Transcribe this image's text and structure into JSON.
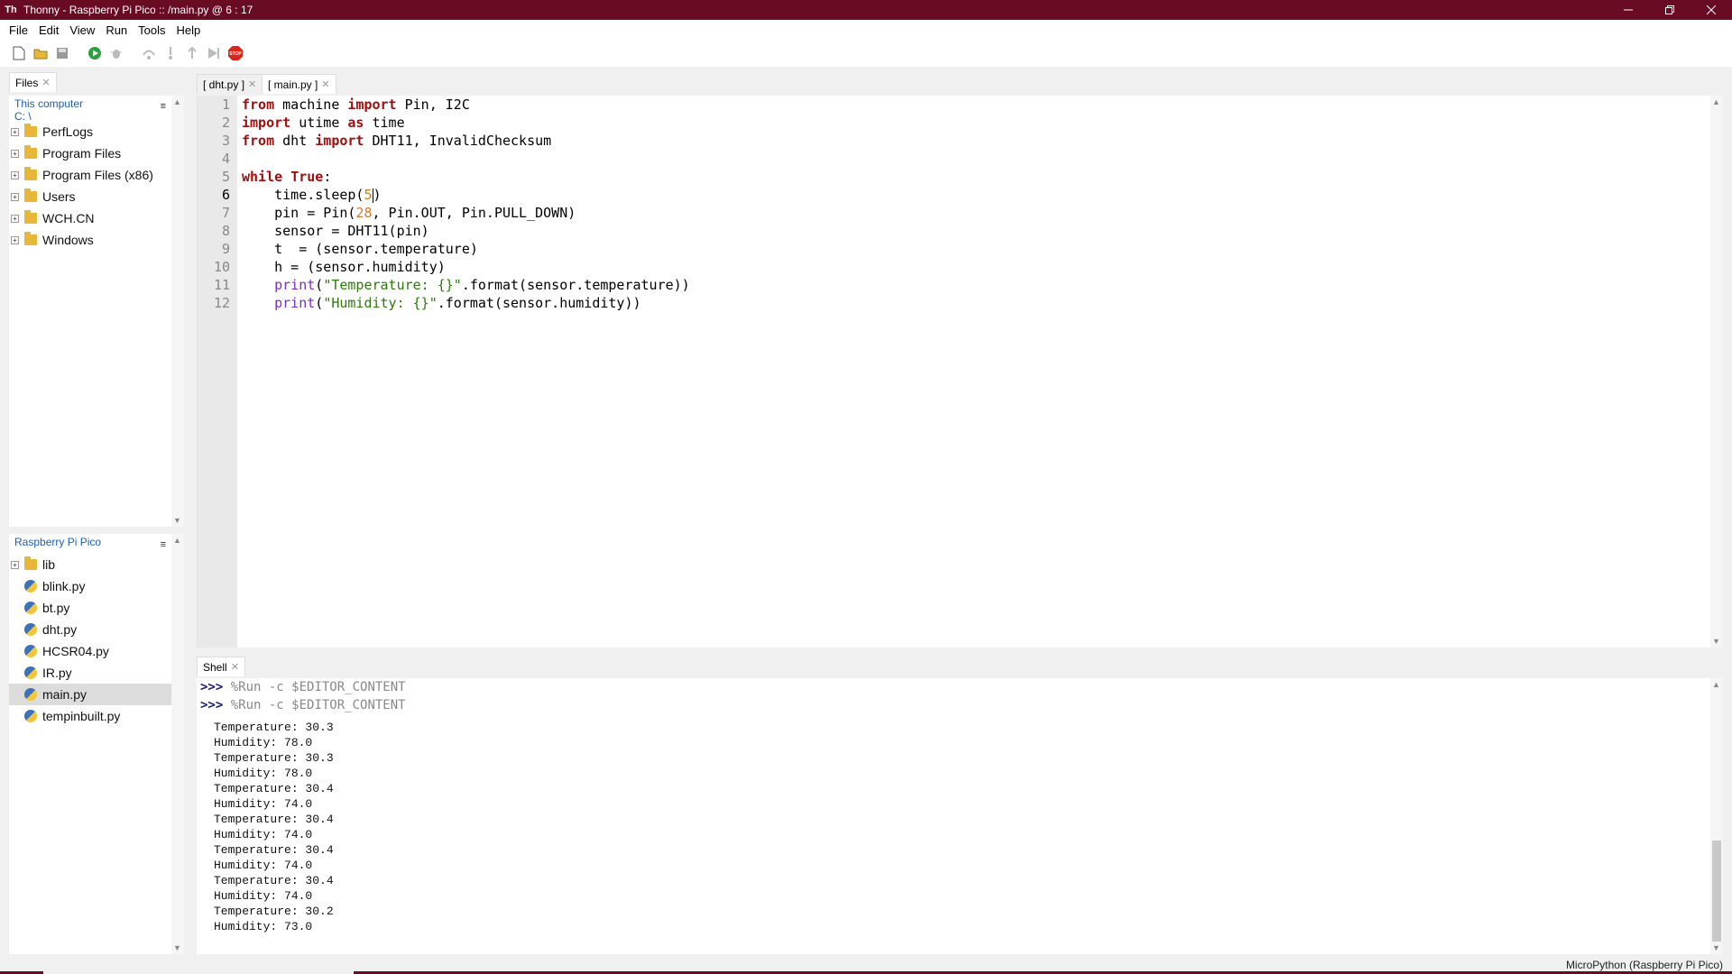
{
  "window": {
    "title": "Thonny  -  Raspberry Pi Pico :: /main.py  @  6 : 17"
  },
  "menu": [
    "File",
    "Edit",
    "View",
    "Run",
    "Tools",
    "Help"
  ],
  "toolbar": {
    "icons": [
      "new-file-icon",
      "open-file-icon",
      "save-icon",
      "run-icon",
      "debug-icon",
      "step-over-icon",
      "step-into-icon",
      "step-out-icon",
      "resume-icon",
      "stop-icon"
    ],
    "stop_label": "STOP"
  },
  "files_panel": {
    "tab_label": "Files",
    "computer": {
      "title": "This computer",
      "path": "C: \\",
      "items": [
        "PerfLogs",
        "Program Files",
        "Program Files (x86)",
        "Users",
        "WCH.CN",
        "Windows"
      ]
    },
    "pico": {
      "title": "Raspberry Pi Pico",
      "items": [
        {
          "name": "lib",
          "type": "folder"
        },
        {
          "name": "blink.py",
          "type": "py"
        },
        {
          "name": "bt.py",
          "type": "py"
        },
        {
          "name": "dht.py",
          "type": "py"
        },
        {
          "name": "HCSR04.py",
          "type": "py"
        },
        {
          "name": "IR.py",
          "type": "py"
        },
        {
          "name": "main.py",
          "type": "py",
          "selected": true
        },
        {
          "name": "tempinbuilt.py",
          "type": "py"
        }
      ]
    }
  },
  "editor": {
    "tabs": [
      "[ dht.py ]",
      "[ main.py ]"
    ],
    "active_tab": 1,
    "current_line": 6,
    "line_numbers": [
      "1",
      "2",
      "3",
      "4",
      "5",
      "6",
      "7",
      "8",
      "9",
      "10",
      "11",
      "12"
    ]
  },
  "shell": {
    "tab_label": "Shell",
    "prompt": ">>>",
    "commands": [
      "%Run -c $EDITOR_CONTENT",
      "%Run -c $EDITOR_CONTENT"
    ],
    "output": [
      "Temperature: 30.3",
      "Humidity: 78.0",
      "Temperature: 30.3",
      "Humidity: 78.0",
      "Temperature: 30.4",
      "Humidity: 74.0",
      "Temperature: 30.4",
      "Humidity: 74.0",
      "Temperature: 30.4",
      "Humidity: 74.0",
      "Temperature: 30.4",
      "Humidity: 74.0",
      "Temperature: 30.2",
      "Humidity: 73.0"
    ]
  },
  "status": {
    "interpreter": "MicroPython (Raspberry Pi Pico)"
  },
  "colors": {
    "titlebar": "#6a0b24",
    "keyword": "#a30d0d",
    "number": "#d27b27",
    "string": "#2b7a0b"
  }
}
